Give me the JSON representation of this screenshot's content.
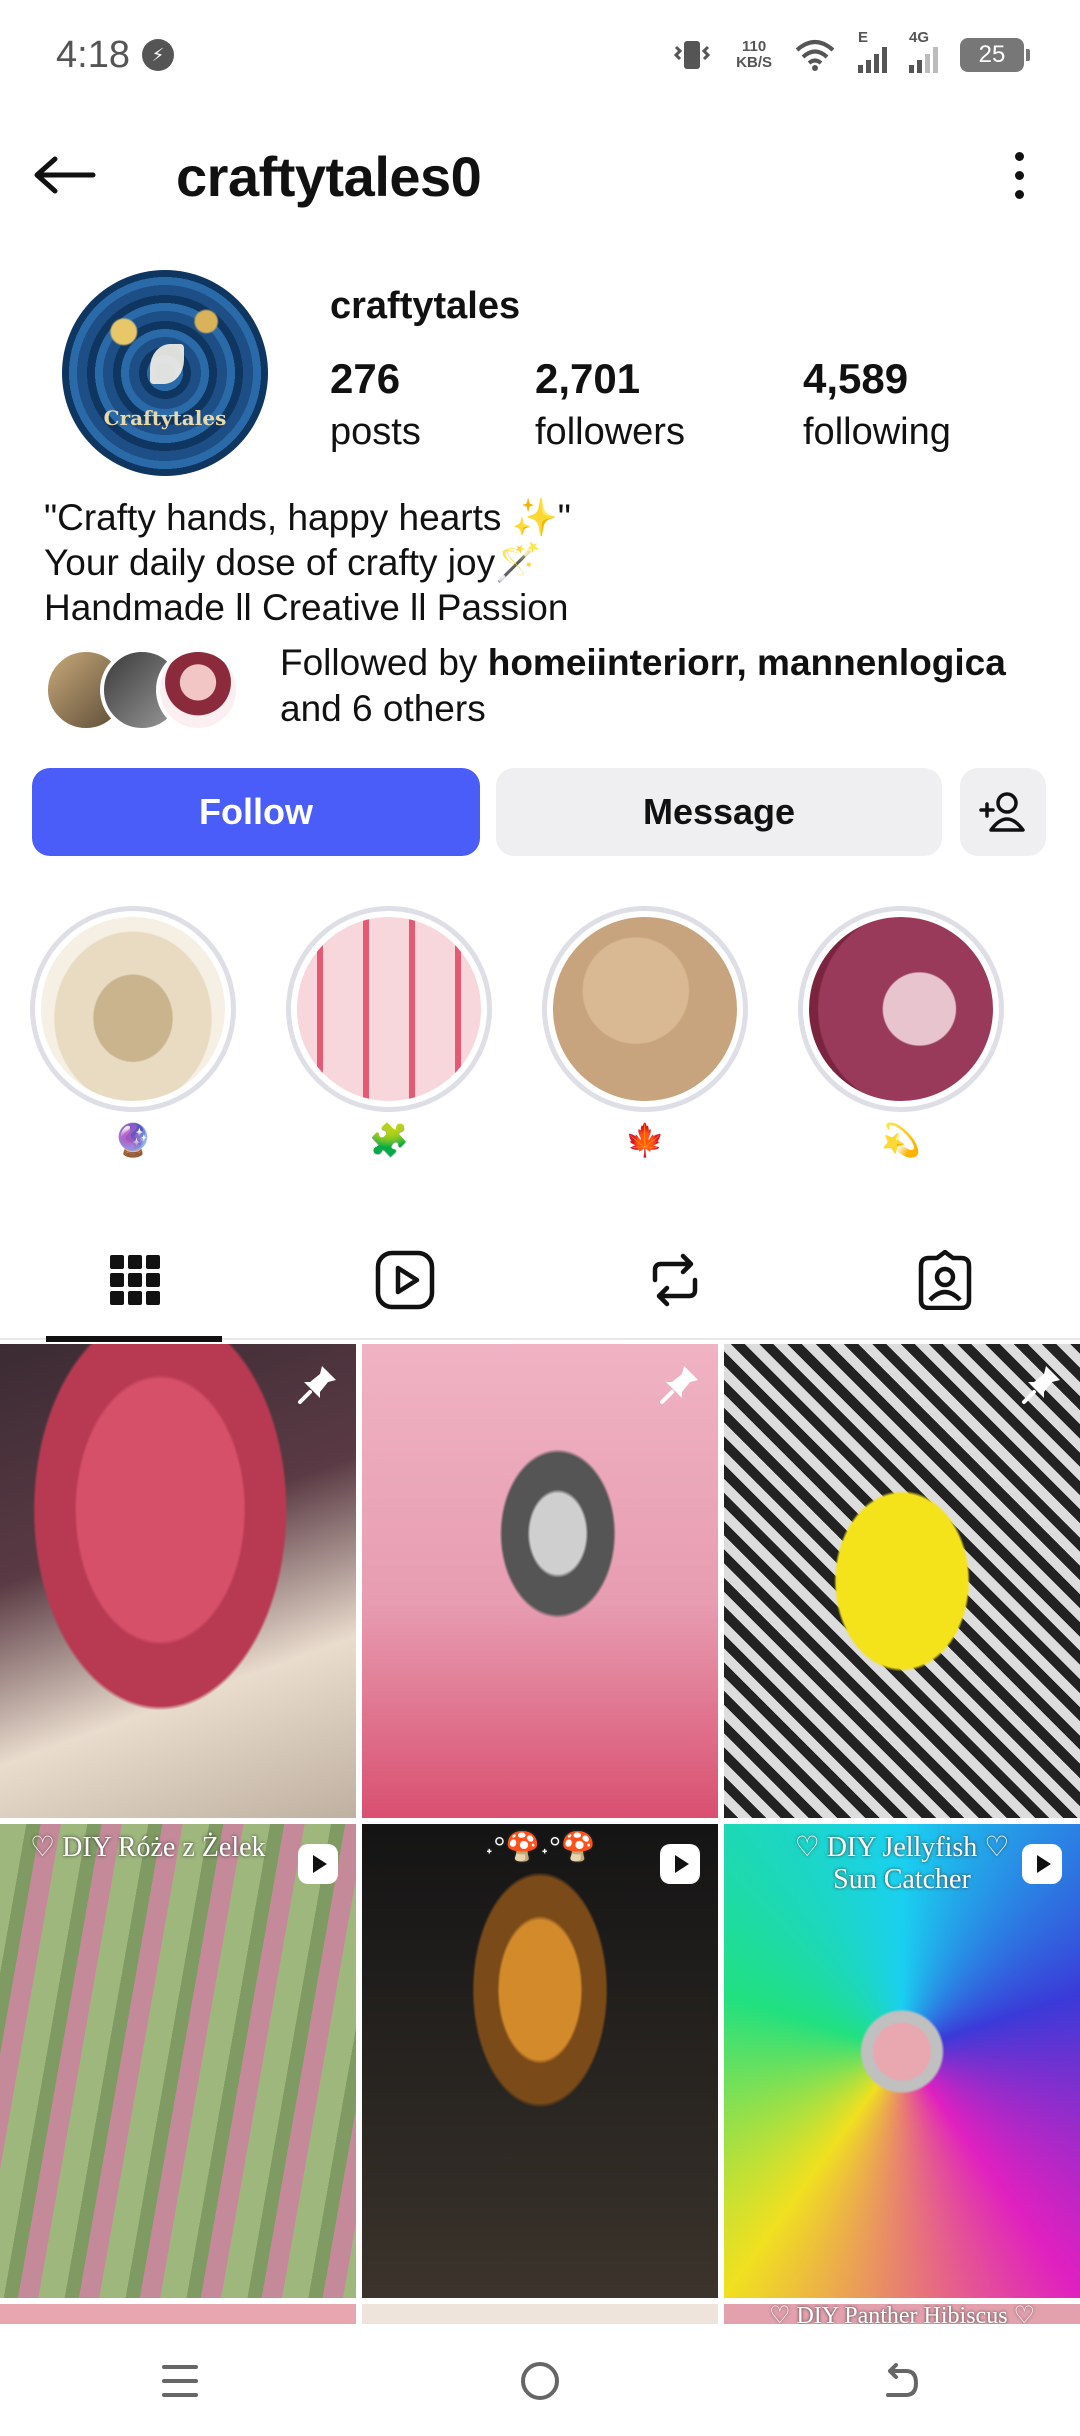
{
  "status_bar": {
    "time": "4:18",
    "net_speed_value": "110",
    "net_speed_unit": "KB/S",
    "network_e": "E",
    "network_4g": "4G",
    "battery": "25"
  },
  "header": {
    "title": "craftytales0"
  },
  "profile": {
    "name": "craftytales",
    "avatar_text": "Craftytales",
    "stats": {
      "posts_count": "276",
      "posts_label": "posts",
      "followers_count": "2,701",
      "followers_label": "followers",
      "following_count": "4,589",
      "following_label": "following"
    },
    "bio_lines": [
      "\"Crafty hands, happy hearts ✨\"",
      "Your daily dose of crafty joy🪄",
      "Handmade ll Creative ll Passion"
    ],
    "followed_by": {
      "prefix": "Followed by ",
      "names": "homeiinteriorr, mannenlogica",
      "suffix": "and 6 others"
    }
  },
  "actions": {
    "follow": "Follow",
    "message": "Message"
  },
  "highlights": [
    {
      "label": "🔮"
    },
    {
      "label": "🧩"
    },
    {
      "label": "🍁"
    },
    {
      "label": "💫"
    }
  ],
  "tabs": [
    {
      "name": "grid"
    },
    {
      "name": "reels"
    },
    {
      "name": "reposts"
    },
    {
      "name": "tagged"
    }
  ],
  "posts": [
    {
      "label": ""
    },
    {
      "label": ""
    },
    {
      "label": ""
    },
    {
      "label": "♡ DIY Róże z Żelek"
    },
    {
      "label": "˖°🍄˖°🍄"
    },
    {
      "label": "♡ DIY Jellyfish ♡\nSun Catcher"
    },
    {
      "label": ""
    },
    {
      "label": ""
    },
    {
      "label": "♡ DIY Panther Hibiscus ♡"
    }
  ]
}
